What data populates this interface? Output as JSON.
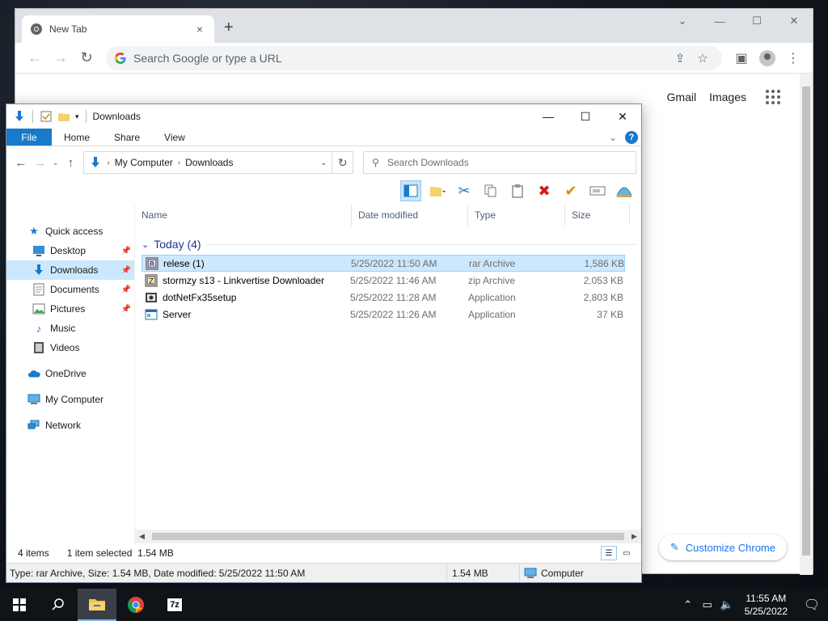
{
  "chrome": {
    "tab_title": "New Tab",
    "tab_close": "×",
    "new_tab": "+",
    "window_controls": {
      "chevron": "⌄",
      "minimize": "—",
      "maximize": "☐",
      "close": "✕"
    },
    "nav": {
      "back": "←",
      "forward": "→",
      "reload": "↻"
    },
    "omnibox_placeholder": "Search Google or type a URL",
    "links": {
      "gmail": "Gmail",
      "images": "Images"
    },
    "customize_label": "Customize Chrome",
    "icons": [
      "chrome-logo-icon",
      "google-g-icon",
      "share-icon",
      "bookmark-star-icon",
      "side-panel-icon",
      "profile-icon",
      "kebab-menu-icon",
      "apps-grid-icon",
      "pencil-icon"
    ]
  },
  "explorer": {
    "title": "Downloads",
    "window_controls": {
      "minimize": "—",
      "maximize": "☐",
      "close": "✕"
    },
    "ribbon": {
      "file": "File",
      "home": "Home",
      "share": "Share",
      "view": "View",
      "expand": "⌄",
      "help": "?"
    },
    "address": {
      "root": "My Computer",
      "current": "Downloads",
      "sep": "›"
    },
    "search_placeholder": "Search Downloads",
    "columns": {
      "name": "Name",
      "date": "Date modified",
      "type": "Type",
      "size": "Size"
    },
    "group_label": "Today (4)",
    "files": [
      {
        "name": "relese (1)",
        "date": "5/25/2022 11:50 AM",
        "type": "rar Archive",
        "size": "1,586 KB",
        "icon": "rar-archive-icon",
        "selected": true
      },
      {
        "name": "stormzy s13 - Linkvertise Downloader",
        "date": "5/25/2022 11:46 AM",
        "type": "zip Archive",
        "size": "2,053 KB",
        "icon": "zip-archive-icon",
        "selected": false
      },
      {
        "name": "dotNetFx35setup",
        "date": "5/25/2022 11:28 AM",
        "type": "Application",
        "size": "2,803 KB",
        "icon": "installer-icon",
        "selected": false
      },
      {
        "name": "Server",
        "date": "5/25/2022 11:26 AM",
        "type": "Application",
        "size": "37 KB",
        "icon": "application-icon",
        "selected": false
      }
    ],
    "nav_items": {
      "quick_access": "Quick access",
      "desktop": "Desktop",
      "downloads": "Downloads",
      "documents": "Documents",
      "pictures": "Pictures",
      "music": "Music",
      "videos": "Videos",
      "onedrive": "OneDrive",
      "my_computer": "My Computer",
      "network": "Network"
    },
    "status": {
      "items": "4 items",
      "selected": "1 item selected",
      "selected_size": "1.54 MB",
      "details": "Type: rar Archive, Size: 1.54 MB, Date modified: 5/25/2022 11:50 AM",
      "size": "1.54 MB",
      "location": "Computer"
    },
    "colors": {
      "accent": "#1979ca",
      "selection": "#cce8ff",
      "group": "#1e3287"
    }
  },
  "taskbar": {
    "time": "11:55 AM",
    "date": "5/25/2022",
    "app_7z": "7z",
    "icons": [
      "windows-start-icon",
      "search-icon",
      "file-explorer-icon",
      "chrome-icon",
      "7zip-icon",
      "chevron-up-icon",
      "network-icon",
      "volume-icon",
      "notification-icon"
    ]
  }
}
